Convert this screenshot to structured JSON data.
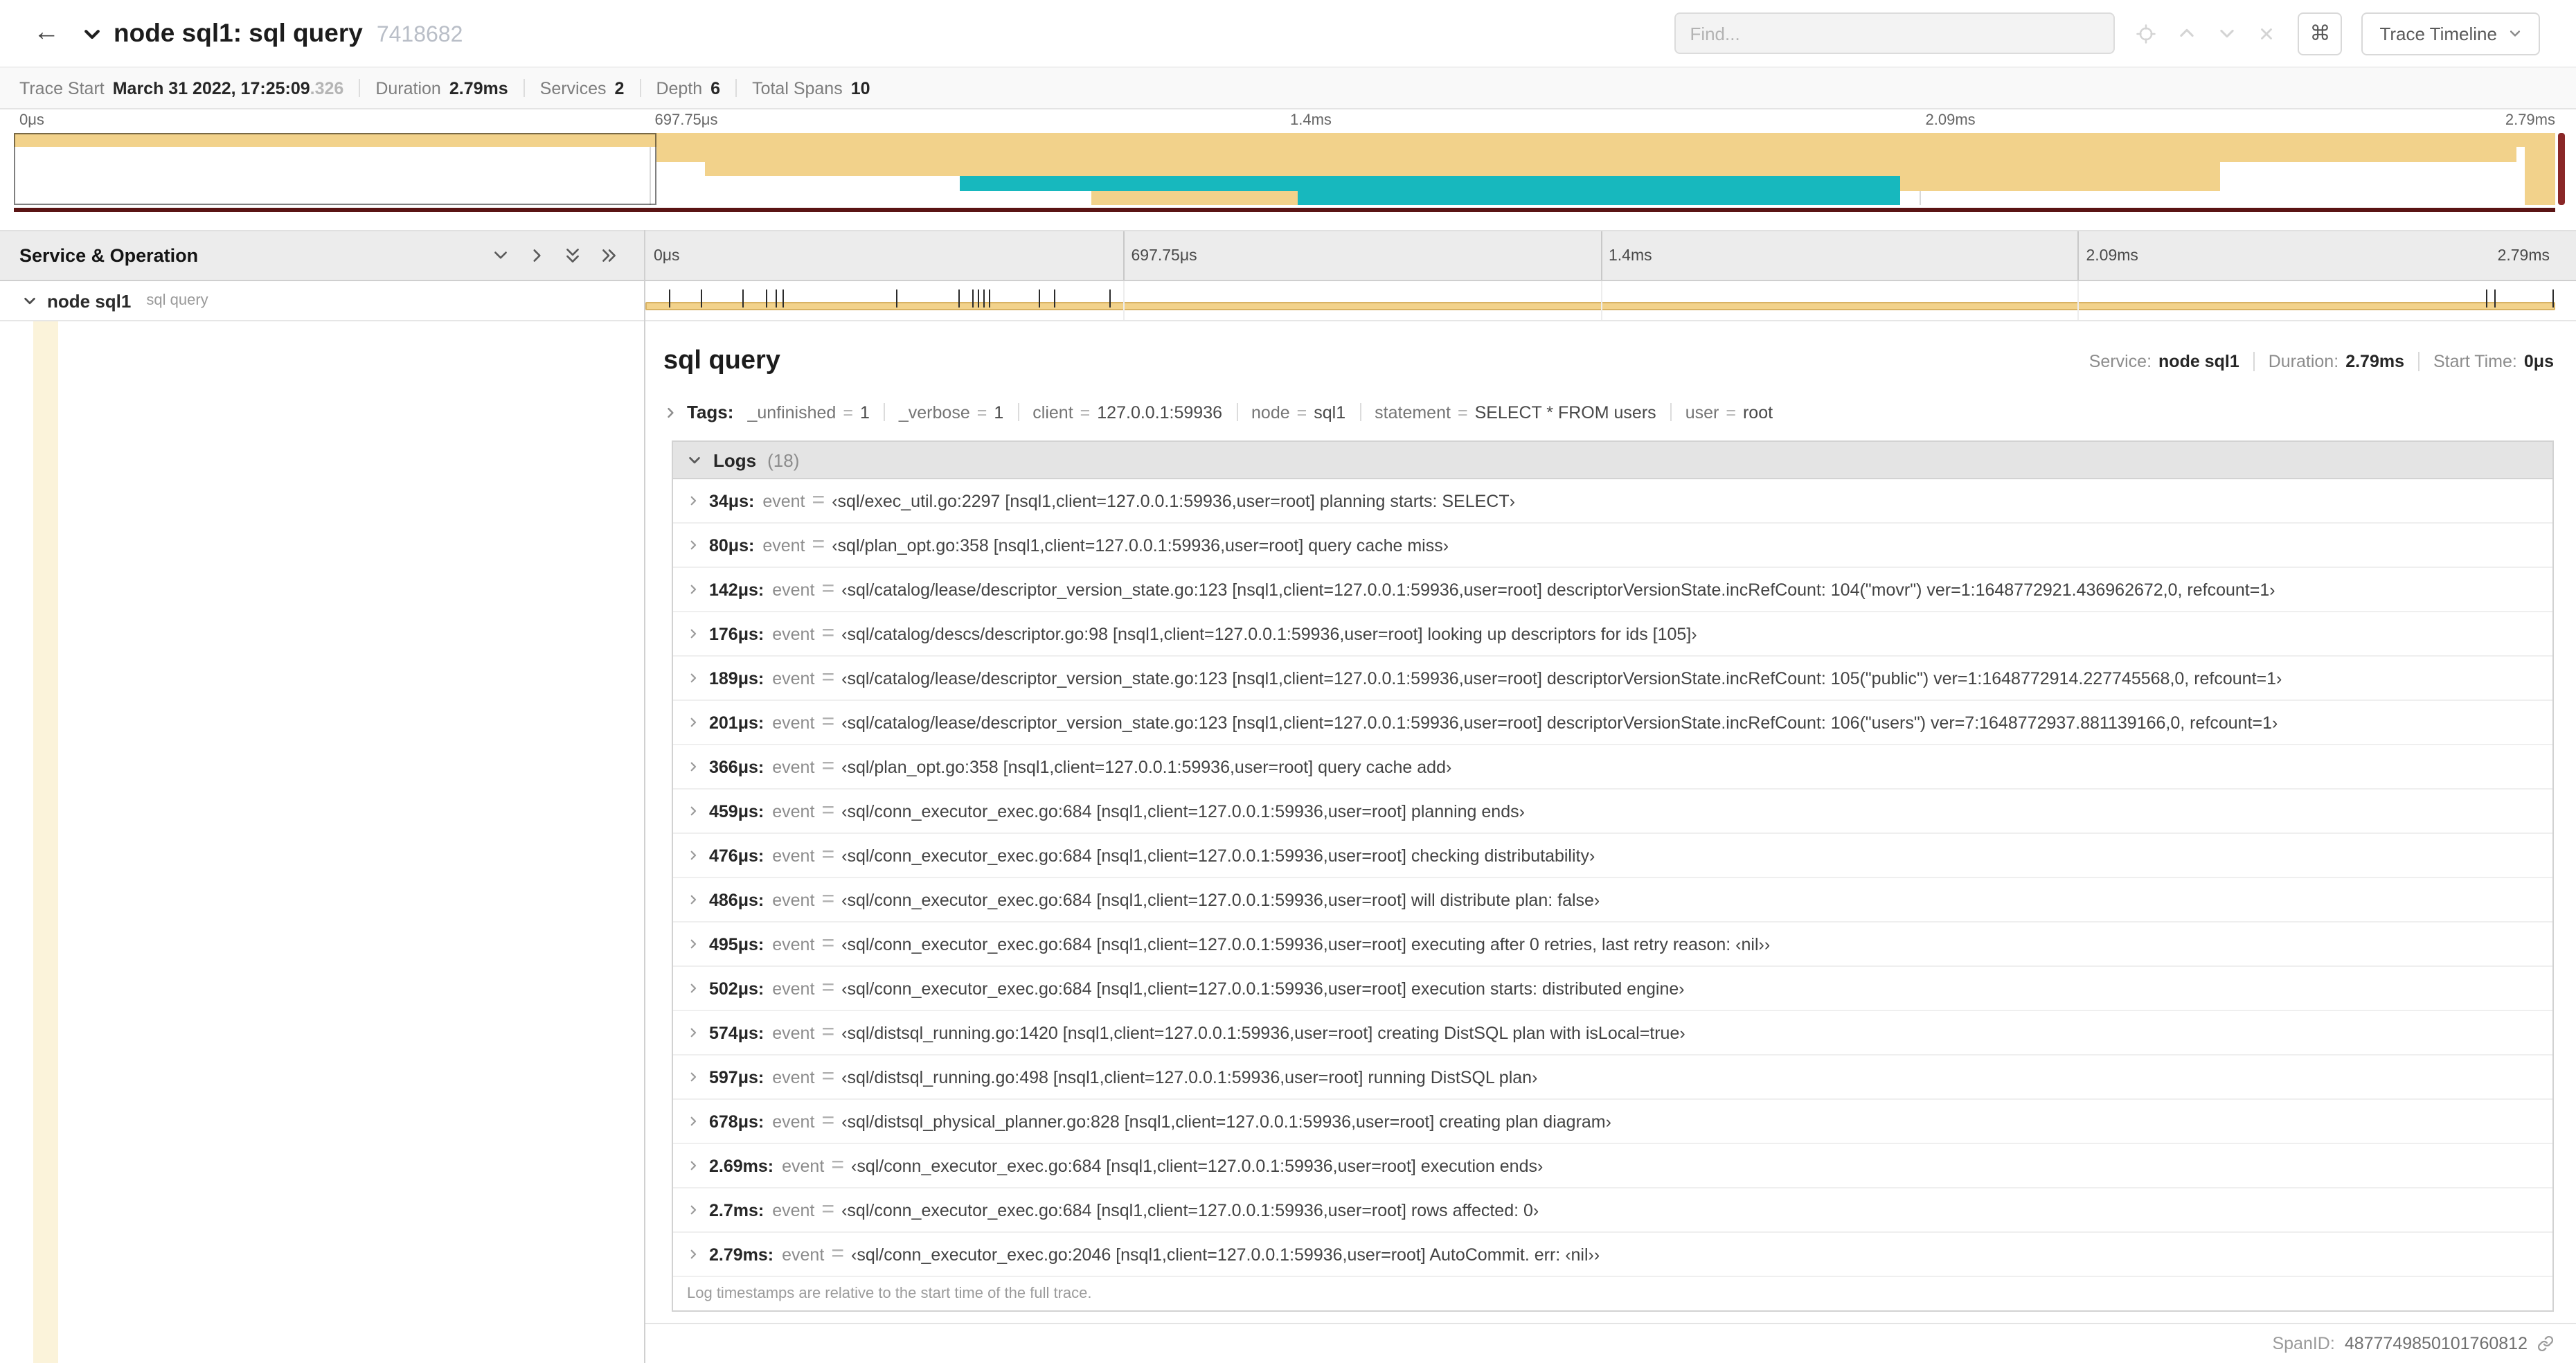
{
  "header": {
    "back_icon": "←",
    "title": "node sql1: sql query",
    "trace_id": "7418682",
    "find_placeholder": "Find...",
    "shortcuts_label": "⌘",
    "view_dropdown": "Trace Timeline"
  },
  "summary": {
    "items": [
      {
        "label": "Trace Start",
        "value": "March 31 2022, 17:25:09",
        "suffix": ".326"
      },
      {
        "label": "Duration",
        "value": "2.79ms"
      },
      {
        "label": "Services",
        "value": "2"
      },
      {
        "label": "Depth",
        "value": "6"
      },
      {
        "label": "Total Spans",
        "value": "10"
      }
    ]
  },
  "minimap": {
    "ticks": [
      "0μs",
      "697.75μs",
      "1.4ms",
      "2.09ms",
      "2.79ms"
    ],
    "grid_pct": [
      25,
      50,
      75
    ],
    "colors": {
      "tan": "#F2D28B",
      "teal": "#17B8BE"
    },
    "scrubber_color": "#5a1414",
    "handle_color": "#8a2727",
    "selection": {
      "start": 0,
      "end": 0.253
    },
    "bars": [
      {
        "row": 0,
        "start": 0.0,
        "end": 1.0,
        "color": "tan"
      },
      {
        "row": 1,
        "start": 0.253,
        "end": 0.985,
        "color": "tan"
      },
      {
        "row": 2,
        "start": 0.272,
        "end": 0.868,
        "color": "tan"
      },
      {
        "row": 3,
        "start": 0.372,
        "end": 0.742,
        "color": "teal"
      },
      {
        "row": 3,
        "start": 0.742,
        "end": 0.868,
        "color": "tan"
      },
      {
        "row": 4,
        "start": 0.424,
        "end": 0.505,
        "color": "tan"
      },
      {
        "row": 4,
        "start": 0.505,
        "end": 0.742,
        "color": "teal"
      },
      {
        "row": 1,
        "start": 0.988,
        "end": 1.0,
        "color": "tan"
      },
      {
        "row": 2,
        "start": 0.988,
        "end": 1.0,
        "color": "tan"
      },
      {
        "row": 3,
        "start": 0.988,
        "end": 1.0,
        "color": "tan"
      },
      {
        "row": 4,
        "start": 0.988,
        "end": 1.0,
        "color": "tan"
      }
    ]
  },
  "timeline": {
    "left_header": "Service & Operation",
    "ruler_ticks": [
      "0μs",
      "697.75μs",
      "1.4ms",
      "2.09ms",
      "2.79ms"
    ],
    "row": {
      "service": "node sql1",
      "operation": "sql query",
      "bar_color": "#F2D28B",
      "indent_color": "#fbf3da",
      "tick_positions_pct": [
        1.2,
        2.9,
        5.1,
        6.3,
        6.8,
        7.2,
        13.1,
        16.4,
        17.1,
        17.4,
        17.7,
        18.0,
        20.6,
        21.4,
        24.3,
        96.4,
        96.8,
        99.85
      ]
    }
  },
  "detail": {
    "title": "sql query",
    "service_label": "Service:",
    "service_value": "node sql1",
    "duration_label": "Duration:",
    "duration_value": "2.79ms",
    "start_label": "Start Time:",
    "start_value": "0μs",
    "tags_label": "Tags:",
    "tags": [
      {
        "key": "_unfinished",
        "value": "1"
      },
      {
        "key": "_verbose",
        "value": "1"
      },
      {
        "key": "client",
        "value": "127.0.0.1:59936"
      },
      {
        "key": "node",
        "value": "sql1"
      },
      {
        "key": "statement",
        "value": "SELECT * FROM users"
      },
      {
        "key": "user",
        "value": "root"
      }
    ],
    "logs_label": "Logs",
    "logs_count": "(18)",
    "logs": [
      {
        "time": "34μs:",
        "key": "event",
        "value": "‹sql/exec_util.go:2297 [nsql1,client=127.0.0.1:59936,user=root] planning starts: SELECT›"
      },
      {
        "time": "80μs:",
        "key": "event",
        "value": "‹sql/plan_opt.go:358 [nsql1,client=127.0.0.1:59936,user=root] query cache miss›"
      },
      {
        "time": "142μs:",
        "key": "event",
        "value": "‹sql/catalog/lease/descriptor_version_state.go:123 [nsql1,client=127.0.0.1:59936,user=root] descriptorVersionState.incRefCount: 104(\"movr\") ver=1:1648772921.436962672,0, refcount=1›"
      },
      {
        "time": "176μs:",
        "key": "event",
        "value": "‹sql/catalog/descs/descriptor.go:98 [nsql1,client=127.0.0.1:59936,user=root] looking up descriptors for ids [105]›"
      },
      {
        "time": "189μs:",
        "key": "event",
        "value": "‹sql/catalog/lease/descriptor_version_state.go:123 [nsql1,client=127.0.0.1:59936,user=root] descriptorVersionState.incRefCount: 105(\"public\") ver=1:1648772914.227745568,0, refcount=1›"
      },
      {
        "time": "201μs:",
        "key": "event",
        "value": "‹sql/catalog/lease/descriptor_version_state.go:123 [nsql1,client=127.0.0.1:59936,user=root] descriptorVersionState.incRefCount: 106(\"users\") ver=7:1648772937.881139166,0, refcount=1›"
      },
      {
        "time": "366μs:",
        "key": "event",
        "value": "‹sql/plan_opt.go:358 [nsql1,client=127.0.0.1:59936,user=root] query cache add›"
      },
      {
        "time": "459μs:",
        "key": "event",
        "value": "‹sql/conn_executor_exec.go:684 [nsql1,client=127.0.0.1:59936,user=root] planning ends›"
      },
      {
        "time": "476μs:",
        "key": "event",
        "value": "‹sql/conn_executor_exec.go:684 [nsql1,client=127.0.0.1:59936,user=root] checking distributability›"
      },
      {
        "time": "486μs:",
        "key": "event",
        "value": "‹sql/conn_executor_exec.go:684 [nsql1,client=127.0.0.1:59936,user=root] will distribute plan: false›"
      },
      {
        "time": "495μs:",
        "key": "event",
        "value": "‹sql/conn_executor_exec.go:684 [nsql1,client=127.0.0.1:59936,user=root] executing after 0 retries, last retry reason: ‹nil››"
      },
      {
        "time": "502μs:",
        "key": "event",
        "value": "‹sql/conn_executor_exec.go:684 [nsql1,client=127.0.0.1:59936,user=root] execution starts: distributed engine›"
      },
      {
        "time": "574μs:",
        "key": "event",
        "value": "‹sql/distsql_running.go:1420 [nsql1,client=127.0.0.1:59936,user=root] creating DistSQL plan with isLocal=true›"
      },
      {
        "time": "597μs:",
        "key": "event",
        "value": "‹sql/distsql_running.go:498 [nsql1,client=127.0.0.1:59936,user=root] running DistSQL plan›"
      },
      {
        "time": "678μs:",
        "key": "event",
        "value": "‹sql/distsql_physical_planner.go:828 [nsql1,client=127.0.0.1:59936,user=root] creating plan diagram›"
      },
      {
        "time": "2.69ms:",
        "key": "event",
        "value": "‹sql/conn_executor_exec.go:684 [nsql1,client=127.0.0.1:59936,user=root] execution ends›"
      },
      {
        "time": "2.7ms:",
        "key": "event",
        "value": "‹sql/conn_executor_exec.go:684 [nsql1,client=127.0.0.1:59936,user=root] rows affected: 0›"
      },
      {
        "time": "2.79ms:",
        "key": "event",
        "value": "‹sql/conn_executor_exec.go:2046 [nsql1,client=127.0.0.1:59936,user=root] AutoCommit. err: ‹nil››"
      }
    ],
    "logs_footnote": "Log timestamps are relative to the start time of the full trace.",
    "span_id_label": "SpanID:",
    "span_id": "4877749850101760812"
  }
}
